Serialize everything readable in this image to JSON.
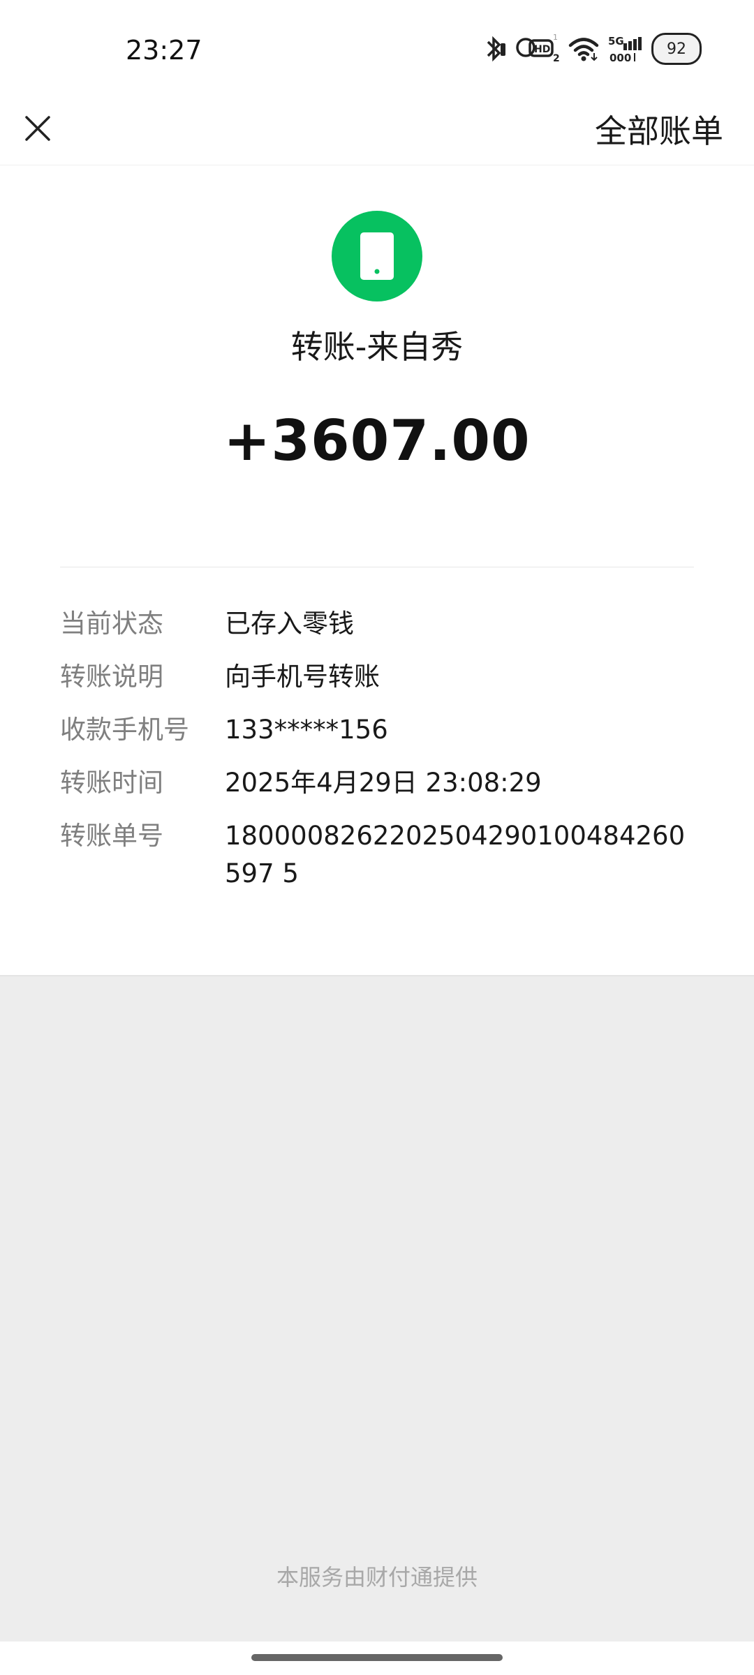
{
  "status_bar": {
    "time": "23:27",
    "battery_level": "92",
    "icons": [
      "bluetooth-icon",
      "hd-signal-icon",
      "wifi-icon",
      "5g-signal-icon",
      "battery-icon"
    ]
  },
  "nav": {
    "close_icon": "close-icon",
    "all_bills_label": "全部账单"
  },
  "transaction": {
    "icon": "phone-icon",
    "icon_color": "#07c160",
    "title": "转账-来自秀",
    "amount": "+3607.00"
  },
  "details": [
    {
      "label": "当前状态",
      "value": "已存入零钱"
    },
    {
      "label": "转账说明",
      "value": "向手机号转账"
    },
    {
      "label": "收款手机号",
      "value": "133*****156"
    },
    {
      "label": "转账时间",
      "value": "2025年4月29日 23:08:29"
    },
    {
      "label": "转账单号",
      "value": "1800008262202504290100484260597 5"
    }
  ],
  "footer": {
    "note": "本服务由财付通提供"
  }
}
